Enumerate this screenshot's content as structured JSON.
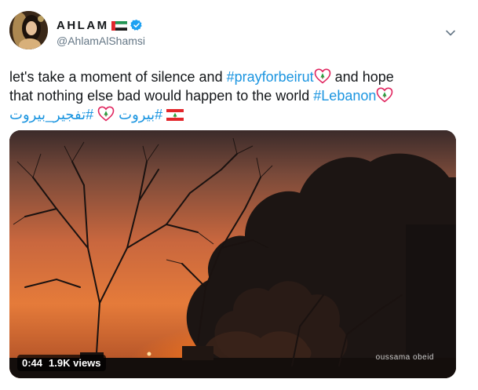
{
  "author": {
    "display_name": "AHLAM",
    "handle": "@AhlamAlShamsi"
  },
  "tweet": {
    "line1_prefix": "let's take a moment of silence and ",
    "hashtag_prayforbeirut": "#prayforbeirut",
    "line1_suffix": " and hope",
    "line2_prefix": "that nothing else bad would happen to the world ",
    "hashtag_lebanon": "#Lebanon",
    "hashtag_arabic_explosion": "#تفجير_بيروت",
    "hashtag_arabic_beirut": "#بيروت"
  },
  "media": {
    "duration": "0:44",
    "views": "1.9K views",
    "watermark": "oussama obeid"
  },
  "icons": {
    "verified": "verified-badge-icon",
    "more": "chevron-down-icon",
    "flag_uae": "uae-flag-emoji",
    "flag_lebanon": "lebanon-flag-emoji",
    "heart_lebanon": "lebanon-heart-emoji"
  },
  "colors": {
    "link": "#1b95e0",
    "handle_gray": "#657786",
    "verified_blue": "#1da1f2"
  }
}
